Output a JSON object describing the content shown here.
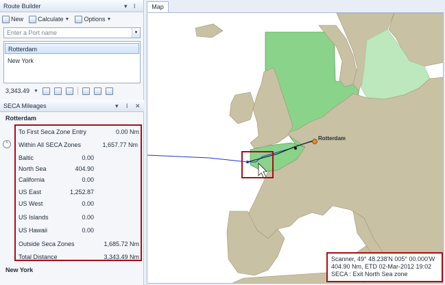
{
  "route_builder": {
    "title": "Route Builder",
    "new_label": "New",
    "calculate_label": "Calculate",
    "options_label": "Options",
    "port_placeholder": "Enter a Port name",
    "ports": [
      "Rotterdam",
      "New York"
    ],
    "distance": "3,343.49"
  },
  "seca": {
    "title": "SECA Mileages",
    "port1": "Rotterdam",
    "port2": "New York",
    "to_first_label": "To First Seca Zone Entry",
    "to_first_value": "0.00 Nm",
    "within_label": "Within All SECA Zones",
    "within_value": "1,657.77 Nm",
    "zones": [
      {
        "name": "Baltic",
        "value": "0.00"
      },
      {
        "name": "North Sea",
        "value": "404.90"
      },
      {
        "name": "California",
        "value": "0.00"
      },
      {
        "name": "US East",
        "value": "1,252.87"
      },
      {
        "name": "US West",
        "value": "0.00"
      },
      {
        "name": "US Islands",
        "value": "0.00"
      },
      {
        "name": "US Hawaii",
        "value": "0.00"
      }
    ],
    "outside_label": "Outside Seca Zones",
    "outside_value": "1,685.72 Nm",
    "total_label": "Total Distance",
    "total_value": "3,343.49 Nm"
  },
  "map": {
    "tab": "Map",
    "rotterdam_label": "Rotterdam",
    "status_line1": "Scanner, 49° 48.238'N 005° 00.000'W",
    "status_line2": "404.90 Nm, ETD 02-Mar-2012 19:02",
    "status_line3": "SECA : Exit North Sea zone"
  },
  "colors": {
    "sea": "#ffffff",
    "land": "#c9c1a3",
    "seca_zone": "#89d38a",
    "highlight": "#a80c15",
    "route": "#1737c7"
  }
}
